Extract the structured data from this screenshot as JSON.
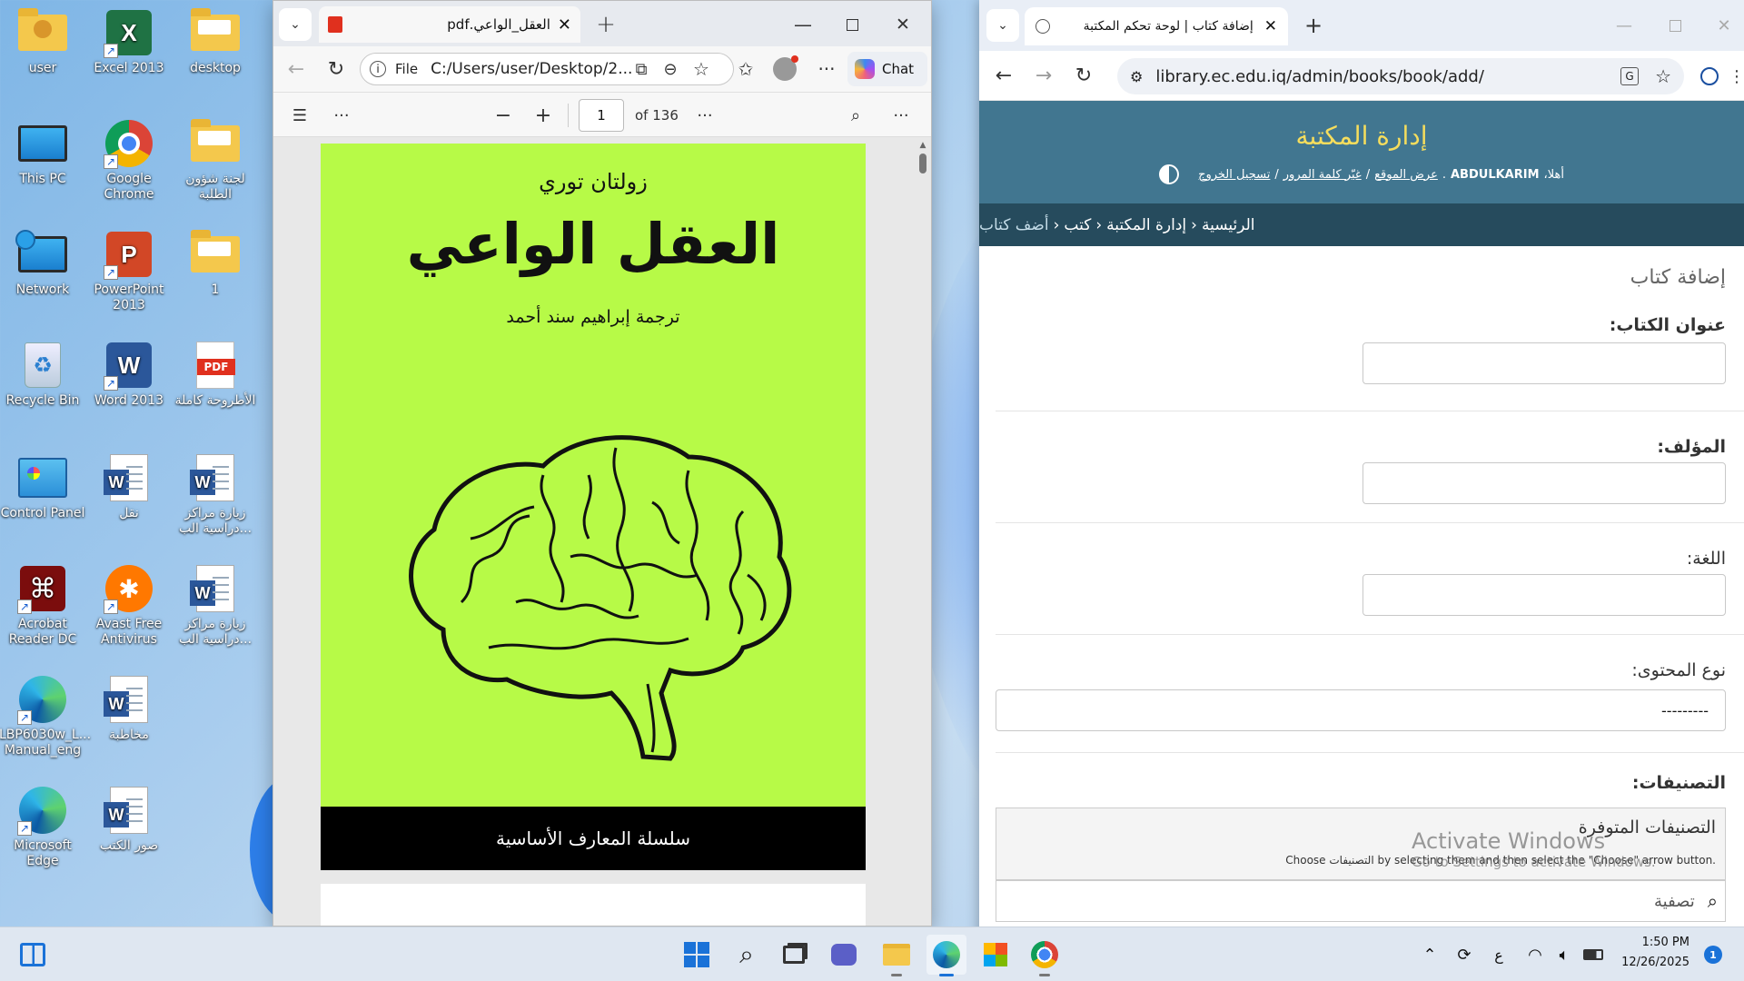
{
  "desktop": {
    "icons": [
      {
        "label": "user",
        "kind": "folder-user"
      },
      {
        "label": "Excel 2013",
        "kind": "excel"
      },
      {
        "label": "desktop",
        "kind": "folder"
      },
      {
        "label": "This PC",
        "kind": "monitor"
      },
      {
        "label": "Google Chrome",
        "kind": "chrome"
      },
      {
        "label": "لجنة شؤون الطلبة",
        "kind": "folder"
      },
      {
        "label": "Network",
        "kind": "network"
      },
      {
        "label": "PowerPoint 2013",
        "kind": "powerpoint"
      },
      {
        "label": "1",
        "kind": "folder"
      },
      {
        "label": "Recycle Bin",
        "kind": "recycle"
      },
      {
        "label": "Word 2013",
        "kind": "word-app"
      },
      {
        "label": "الأطروحة كاملة",
        "kind": "pdf"
      },
      {
        "label": "Control Panel",
        "kind": "control"
      },
      {
        "label": "نقل",
        "kind": "word-doc"
      },
      {
        "label": "زيارة مراكز دراسية الب...",
        "kind": "word-doc"
      },
      {
        "label": "Acrobat Reader DC",
        "kind": "acrobat"
      },
      {
        "label": "Avast Free Antivirus",
        "kind": "avast"
      },
      {
        "label": "زيارة مراكز دراسية الب...",
        "kind": "word-doc"
      },
      {
        "label": "LBP6030w_L... Manual_eng",
        "kind": "edge"
      },
      {
        "label": "مخاطبة",
        "kind": "word-doc"
      },
      {
        "label": "Microsoft Edge",
        "kind": "edge"
      },
      {
        "label": "صور الكتب",
        "kind": "word-doc"
      }
    ]
  },
  "pdf_window": {
    "tab_title": "العقل_الواعي.pdf",
    "address": {
      "scheme": "File",
      "path": "C:/Users/user/Desktop/2..."
    },
    "chat_label": "Chat",
    "toolbar": {
      "page_current": "1",
      "page_total": "of 136"
    },
    "page": {
      "author": "زولتان توري",
      "title": "العقل الواعي",
      "translator": "ترجمة إبراهيم سند أحمد",
      "series": "سلسلة المعارف الأساسية"
    }
  },
  "chrome_window": {
    "tab_title": "إضافة كتاب | لوحة تحكم المكتبة",
    "url": "library.ec.edu.iq/admin/books/book/add/",
    "admin": {
      "site_title": "إدارة المكتبة",
      "welcome": "أهلا،",
      "user": "ABDULKARIM",
      "links": [
        "عرض الموقع",
        "غيّر كلمة المرور",
        "تسجيل الخروج"
      ]
    },
    "breadcrumb": [
      "الرئيسية",
      "إدارة المكتبة",
      "كتب",
      "أضف كتاب"
    ],
    "page_heading": "إضافة كتاب",
    "fields": [
      {
        "label": "عنوان الكتاب:",
        "value": ""
      },
      {
        "label": "المؤلف:",
        "value": ""
      },
      {
        "label": "اللغة:",
        "value": ""
      }
    ],
    "content_type": {
      "label": "نوع المحتوى:",
      "selected": "---------"
    },
    "categories": {
      "label": "التصنيفات:",
      "available_title": "التصنيفات المتوفرة",
      "help": "Choose التصنيفات by selecting them and then select the \"Choose\" arrow button.",
      "filter_placeholder": "تصفية"
    }
  },
  "watermark": {
    "line1": "Activate Windows",
    "line2": "Go to Settings to activate Windows."
  },
  "taskbar": {
    "clock_time": "1:50 PM",
    "clock_date": "12/26/2025",
    "lang": "ع",
    "notif_count": "1"
  },
  "colors": {
    "django_header": "#417690",
    "django_crumb": "#264b5d",
    "site_title": "#f5dd5d",
    "book_cover": "#b7fa47"
  }
}
